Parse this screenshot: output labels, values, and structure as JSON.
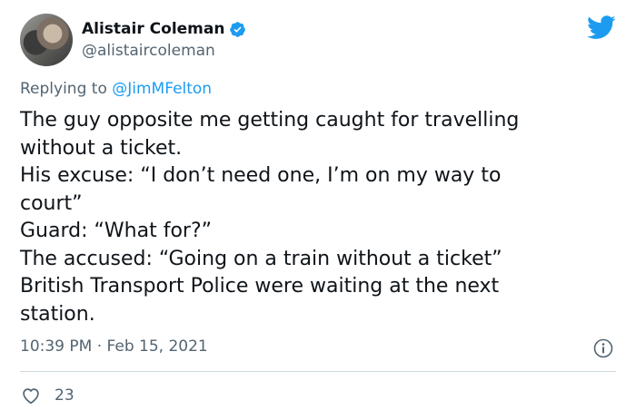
{
  "author": {
    "name": "Alistair Coleman",
    "handle": "@alistaircoleman",
    "verified_icon": "verified-badge-icon"
  },
  "reply": {
    "prefix": "Replying to ",
    "mention": "@JimMFelton"
  },
  "tweet": {
    "lines": [
      "The guy opposite me getting caught for travelling",
      "without a ticket.",
      "His excuse: “I don’t need one, I’m on my way to",
      "court”",
      "Guard: “What for?”",
      "The accused: “Going on a train without a ticket”",
      "British Transport Police were waiting at the next",
      "station."
    ]
  },
  "meta": {
    "time": "10:39 PM",
    "separator": "·",
    "date": "Feb 15, 2021"
  },
  "stats": {
    "likes": "23"
  },
  "colors": {
    "brand_blue": "#1d9bf0",
    "text_primary": "#0f1419",
    "text_secondary": "#536471"
  }
}
